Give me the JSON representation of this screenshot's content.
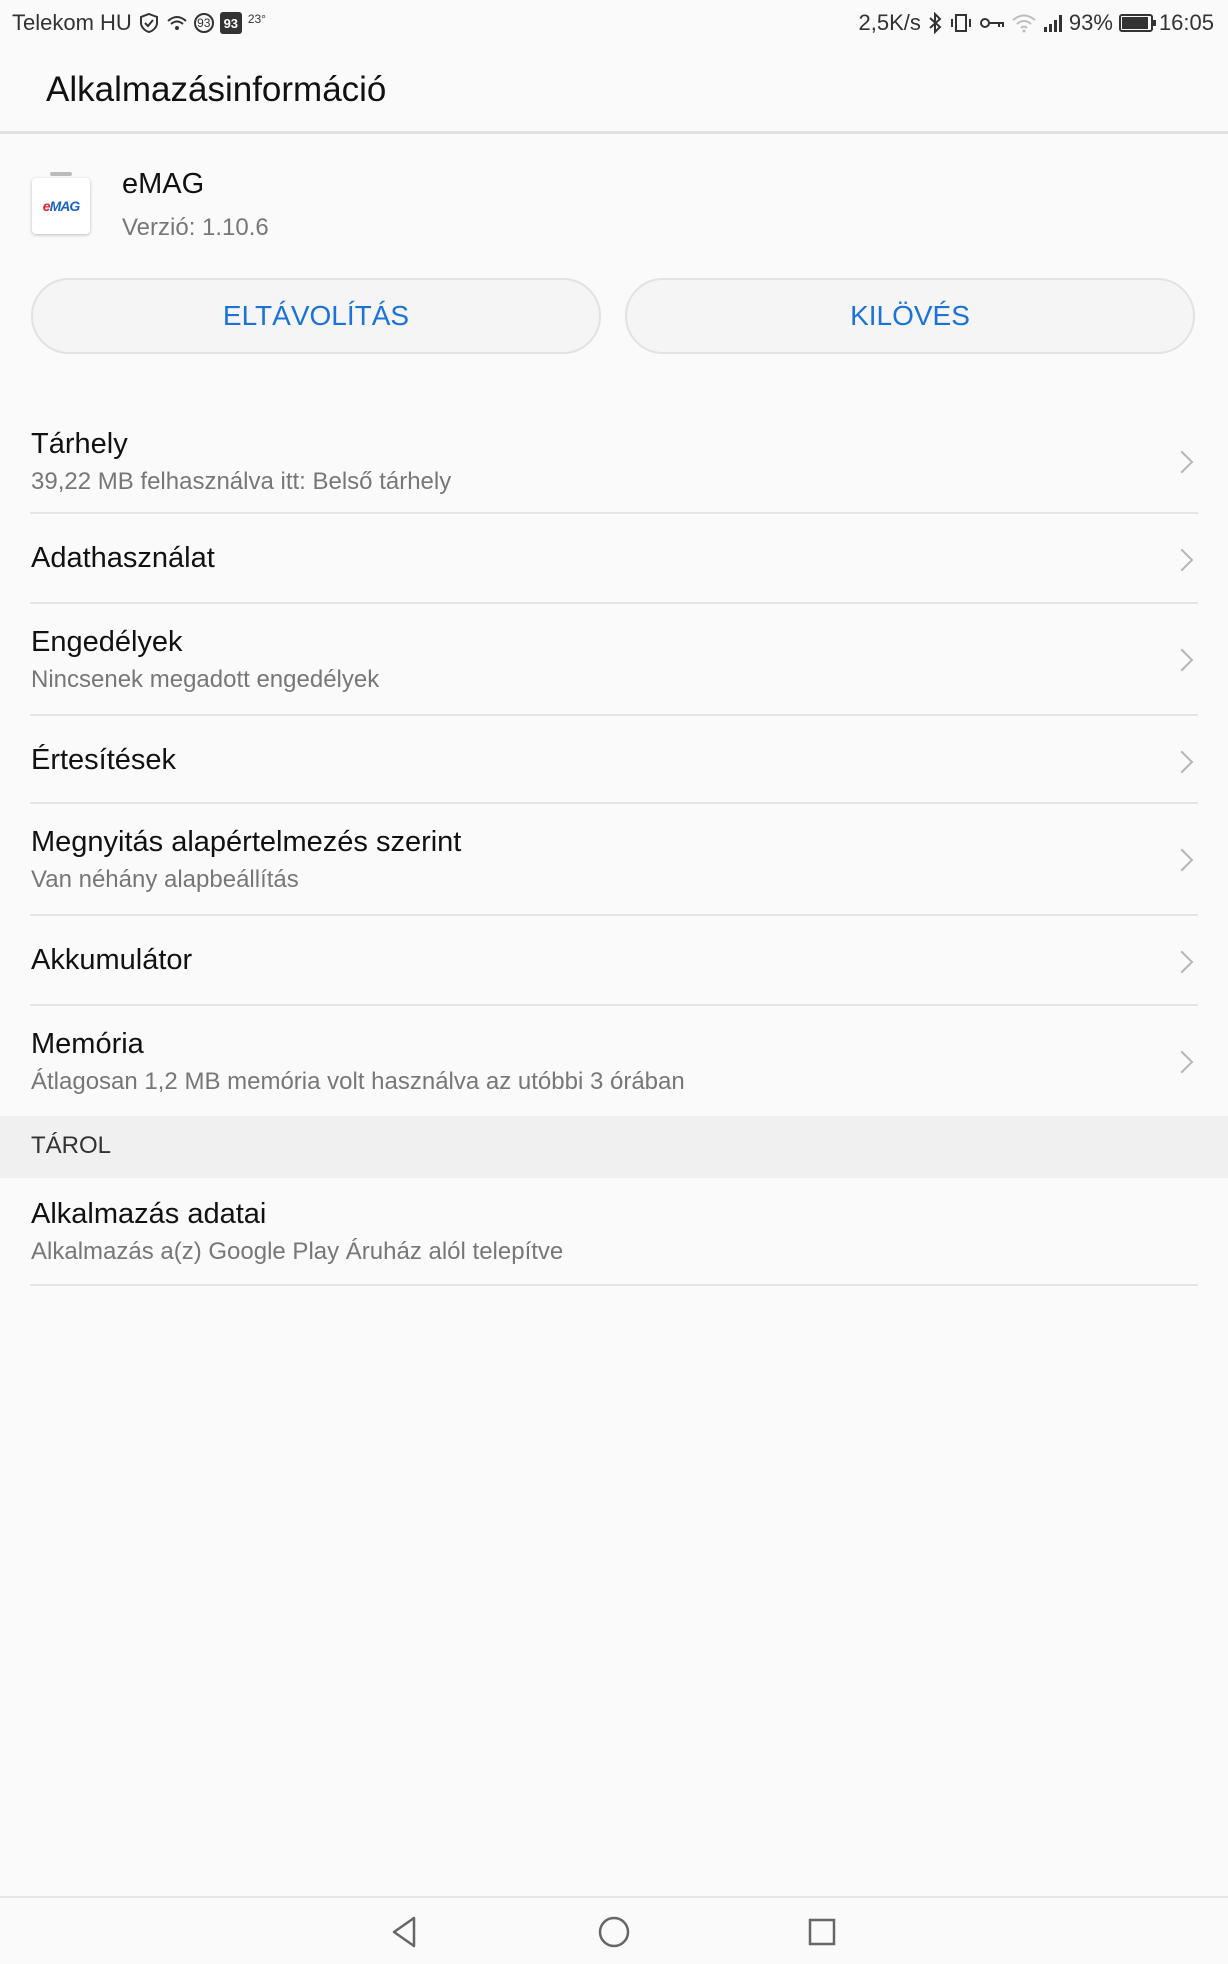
{
  "status_bar": {
    "carrier": "Telekom HU",
    "notif_badge_1": "93",
    "notif_badge_2": "93",
    "temperature": "23°",
    "net_speed": "2,5K/s",
    "battery_percent": "93%",
    "battery_level": 0.93,
    "time": "16:05",
    "icons": [
      "shield-icon",
      "wifi-calling-icon",
      "bluetooth-icon",
      "vibrate-icon",
      "vpn-key-icon",
      "wifi-icon",
      "signal-icon",
      "battery-icon"
    ]
  },
  "app_bar": {
    "title": "Alkalmazásinformáció"
  },
  "app": {
    "icon_text_e": "e",
    "icon_text_rest": "MAG",
    "name": "eMAG",
    "version": "Verzió: 1.10.6"
  },
  "actions": {
    "uninstall_label": "ELTÁVOLÍTÁS",
    "force_stop_label": "KILÖVÉS",
    "accent_color": "#1b73d8"
  },
  "settings": {
    "items": [
      {
        "title": "Tárhely",
        "subtitle": "39,22 MB felhasználva itt: Belső tárhely"
      },
      {
        "title": "Adathasználat",
        "subtitle": ""
      },
      {
        "title": "Engedélyek",
        "subtitle": "Nincsenek megadott engedélyek"
      },
      {
        "title": "Értesítések",
        "subtitle": ""
      },
      {
        "title": "Megnyitás alapértelmezés szerint",
        "subtitle": "Van néhány alapbeállítás"
      },
      {
        "title": "Akkumulátor",
        "subtitle": ""
      },
      {
        "title": "Memória",
        "subtitle": "Átlagosan 1,2 MB memória volt használva az utóbbi 3 órában"
      }
    ]
  },
  "store_section": {
    "header": "TÁROL",
    "item": {
      "title": "Alkalmazás adatai",
      "subtitle": "Alkalmazás a(z) Google Play Áruház alól telepítve"
    }
  },
  "nav_bar": {
    "icons": [
      "back-icon",
      "home-icon",
      "recents-icon"
    ]
  }
}
